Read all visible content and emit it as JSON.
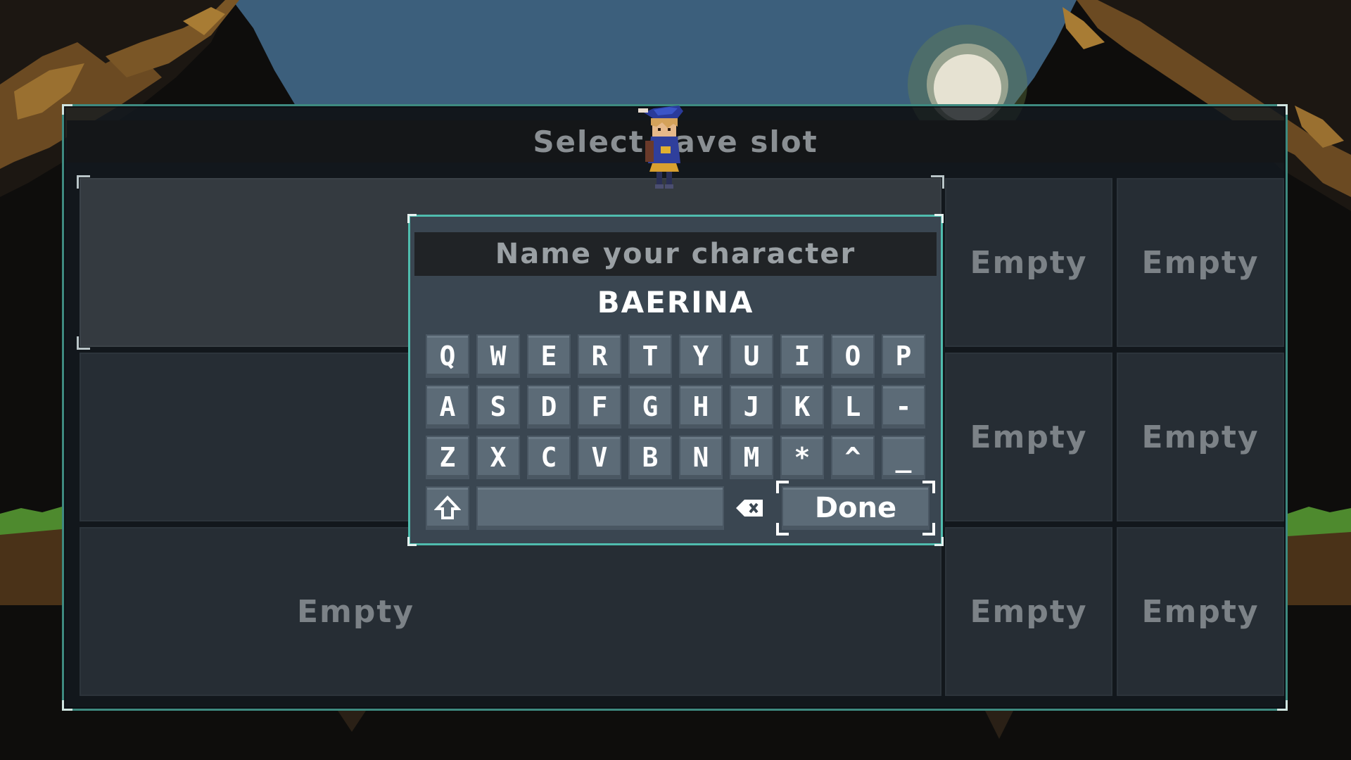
{
  "save_panel": {
    "title": "Select save slot",
    "slots": [
      "Empty",
      "Empty",
      "Empty",
      "Empty",
      "Empty",
      "Empty",
      "Empty"
    ]
  },
  "name_dialog": {
    "title": "Name your character",
    "value": "BAERINA",
    "keyboard": {
      "row1": [
        "Q",
        "W",
        "E",
        "R",
        "T",
        "Y",
        "U",
        "I",
        "O",
        "P"
      ],
      "row2": [
        "A",
        "S",
        "D",
        "F",
        "G",
        "H",
        "J",
        "K",
        "L",
        "-"
      ],
      "row3": [
        "Z",
        "X",
        "C",
        "V",
        "B",
        "N",
        "M",
        "*",
        "^",
        "_"
      ],
      "shift_icon": "shift-arrow-icon",
      "backspace_icon": "backspace-icon",
      "done_label": "Done"
    }
  },
  "colors": {
    "frame_teal": "#4fbcae",
    "dialog_bg": "#3a4651",
    "key_bg": "#5c6b77",
    "sky": "#3c5f7c",
    "sun": "#e6e2d2"
  }
}
